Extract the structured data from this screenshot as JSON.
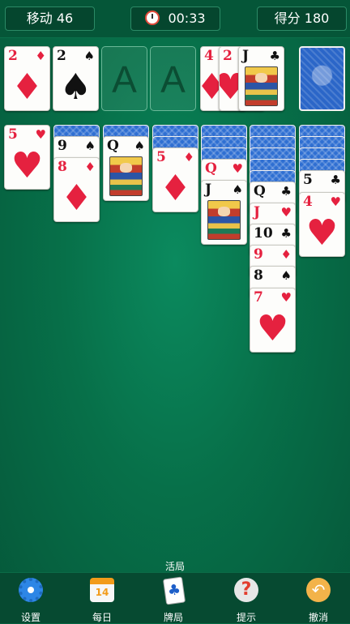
{
  "header": {
    "moves_label": "移动 46",
    "timer": "00:33",
    "score_label": "得分 180"
  },
  "foundation": {
    "empty_label": "A"
  },
  "status": "活局",
  "nav": [
    {
      "label": "设置",
      "icon": "gear-icon"
    },
    {
      "label": "每日",
      "icon": "calendar-icon",
      "badge": "14"
    },
    {
      "label": "牌局",
      "icon": "cards-icon"
    },
    {
      "label": "提示",
      "icon": "hint-icon"
    },
    {
      "label": "撤消",
      "icon": "undo-icon"
    }
  ],
  "cards": {
    "waste_1": {
      "rank": "2",
      "suit": "♦"
    },
    "waste_2": {
      "rank": "2",
      "suit": "♠"
    },
    "fnd_a": {
      "rank": "4",
      "suit": "♦"
    },
    "fnd_b": {
      "rank": "2",
      "suit": "♥"
    },
    "fnd_c": {
      "rank": "J",
      "suit": "♣"
    },
    "t1_1": {
      "rank": "5",
      "suit": "♥"
    },
    "t2_1": {
      "rank": "9",
      "suit": "♠"
    },
    "t2_2": {
      "rank": "8",
      "suit": "♦"
    },
    "t3_1": {
      "rank": "Q",
      "suit": "♠"
    },
    "t4_1": {
      "rank": "5",
      "suit": "♦"
    },
    "t5_1": {
      "rank": "Q",
      "suit": "♥"
    },
    "t5_2": {
      "rank": "J",
      "suit": "♠"
    },
    "t6_1": {
      "rank": "Q",
      "suit": "♣"
    },
    "t6_2": {
      "rank": "J",
      "suit": "♥"
    },
    "t6_3": {
      "rank": "10",
      "suit": "♣"
    },
    "t6_4": {
      "rank": "9",
      "suit": "♦"
    },
    "t6_5": {
      "rank": "8",
      "suit": "♠"
    },
    "t6_6": {
      "rank": "7",
      "suit": "♥"
    },
    "t7_1": {
      "rank": "5",
      "suit": "♣"
    },
    "t7_2": {
      "rank": "4",
      "suit": "♥"
    }
  },
  "colors": {
    "felt": "#077049",
    "red_suit": "#e5213f",
    "card_back": "#2f6fd2"
  }
}
